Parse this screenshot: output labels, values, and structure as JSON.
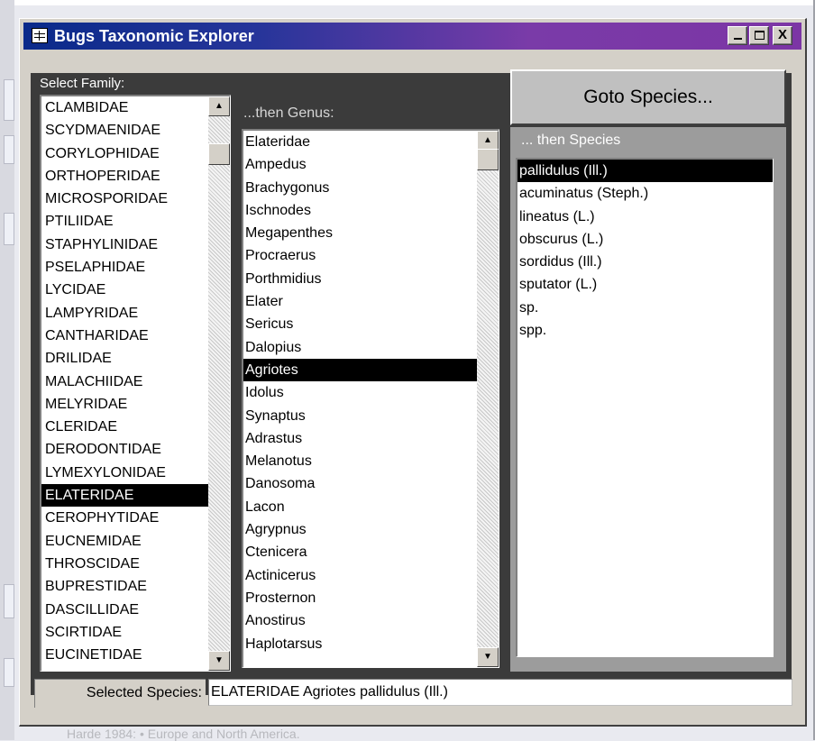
{
  "window": {
    "title": "Bugs Taxonomic Explorer",
    "minimize_label": "_",
    "close_label": "X"
  },
  "family": {
    "label": "Select Family:",
    "items": [
      "CLAMBIDAE",
      "SCYDMAENIDAE",
      "CORYLOPHIDAE",
      "ORTHOPERIDAE",
      "MICROSPORIDAE",
      "PTILIIDAE",
      "STAPHYLINIDAE",
      "PSELAPHIDAE",
      "LYCIDAE",
      "LAMPYRIDAE",
      "CANTHARIDAE",
      "DRILIDAE",
      "MALACHIIDAE",
      "MELYRIDAE",
      "CLERIDAE",
      "DERODONTIDAE",
      "LYMEXYLONIDAE",
      "ELATERIDAE",
      "CEROPHYTIDAE",
      "EUCNEMIDAE",
      "THROSCIDAE",
      "BUPRESTIDAE",
      "DASCILLIDAE",
      "SCIRTIDAE",
      "EUCINETIDAE"
    ],
    "selected": "ELATERIDAE"
  },
  "genus": {
    "label": "...then Genus:",
    "items": [
      "Elateridae",
      "Ampedus",
      "Brachygonus",
      "Ischnodes",
      "Megapenthes",
      "Procraerus",
      "Porthmidius",
      "Elater",
      "Sericus",
      "Dalopius",
      "Agriotes",
      "Idolus",
      "Synaptus",
      "Adrastus",
      "Melanotus",
      "Danosoma",
      "Lacon",
      "Agrypnus",
      "Ctenicera",
      "Actinicerus",
      "Prosternon",
      "Anostirus",
      "Haplotarsus"
    ],
    "selected": "Agriotes"
  },
  "species": {
    "label": "... then Species",
    "items": [
      "pallidulus (Ill.)",
      "acuminatus (Steph.)",
      "lineatus (L.)",
      "obscurus (L.)",
      "sordidus (Ill.)",
      "sputator (L.)",
      "sp.",
      "spp."
    ],
    "selected": "pallidulus (Ill.)"
  },
  "goto_button_label": "Goto Species...",
  "status": {
    "label": "Selected Species:",
    "value": "ELATERIDAE Agriotes pallidulus (Ill.)"
  },
  "background_text": "Harde 1984: • Europe and North America.",
  "icons": {
    "window": "table-window-icon",
    "scroll_up": "triangle-up-icon",
    "scroll_down": "triangle-down-icon"
  }
}
